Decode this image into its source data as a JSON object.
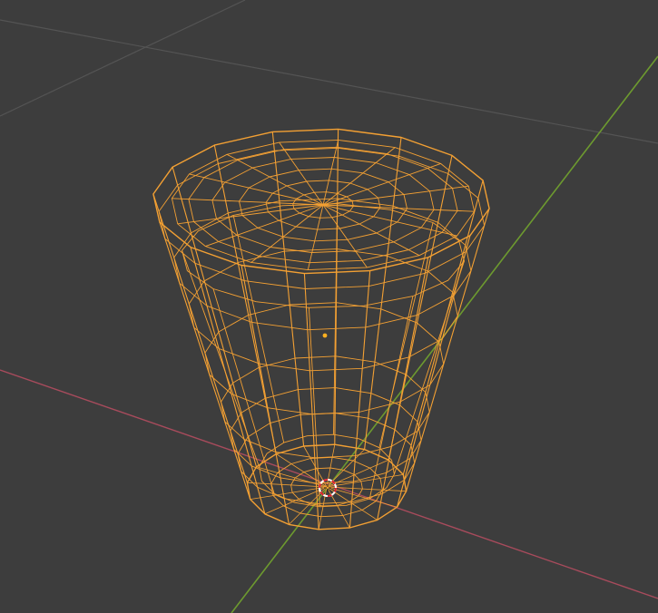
{
  "viewport": {
    "mode": "wireframe",
    "background_color": "#3d3d3d",
    "grid_line_color": "#545454",
    "x_axis_color": "#a84b5c",
    "y_axis_color": "#6d9a2f",
    "selection_color": "#f3a033",
    "origin_color": "#ffb020",
    "object": {
      "shape": "tapered cup",
      "selected": true,
      "top_segments": 16,
      "rings": 8
    },
    "cursor_3d": {
      "icon": "3d-cursor-icon",
      "ring_colors": [
        "#e0202a",
        "#ffffff"
      ]
    }
  }
}
